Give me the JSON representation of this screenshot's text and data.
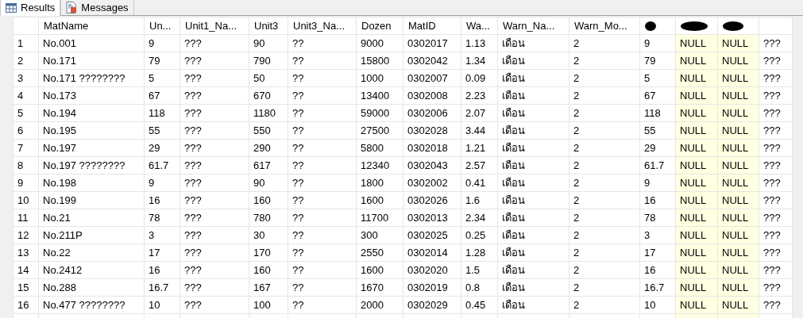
{
  "tabs": [
    {
      "label": "Results",
      "selected": true
    },
    {
      "label": "Messages",
      "selected": false
    }
  ],
  "table": {
    "columns": [
      {
        "kind": "blank"
      },
      {
        "kind": "text",
        "label": "MatName"
      },
      {
        "kind": "text",
        "label": "Un..."
      },
      {
        "kind": "text",
        "label": "Unit1_Na..."
      },
      {
        "kind": "text",
        "label": "Unit3"
      },
      {
        "kind": "text",
        "label": "Unit3_Na..."
      },
      {
        "kind": "text",
        "label": "Dozen"
      },
      {
        "kind": "text",
        "label": "MatID"
      },
      {
        "kind": "text",
        "label": "Wa..."
      },
      {
        "kind": "text",
        "label": "Warn_Na..."
      },
      {
        "kind": "text",
        "label": "Warn_Mo..."
      },
      {
        "kind": "redacted"
      },
      {
        "kind": "redacted"
      },
      {
        "kind": "redacted"
      },
      {
        "kind": "blank"
      }
    ],
    "rows": [
      [
        "1",
        "No.001",
        "9",
        "???",
        "90",
        "??",
        "9000",
        "0302017",
        "1.13",
        "เดือน",
        "2",
        "9",
        "NULL",
        "NULL",
        "???"
      ],
      [
        "2",
        "No.171",
        "79",
        "???",
        "790",
        "??",
        "15800",
        "0302042",
        "1.34",
        "เดือน",
        "2",
        "79",
        "NULL",
        "NULL",
        "???"
      ],
      [
        "3",
        "No.171 ????????",
        "5",
        "???",
        "50",
        "??",
        "1000",
        "0302007",
        "0.09",
        "เดือน",
        "2",
        "5",
        "NULL",
        "NULL",
        "???"
      ],
      [
        "4",
        "No.173",
        "67",
        "???",
        "670",
        "??",
        "13400",
        "0302008",
        "2.23",
        "เดือน",
        "2",
        "67",
        "NULL",
        "NULL",
        "???"
      ],
      [
        "5",
        "No.194",
        "118",
        "???",
        "1180",
        "??",
        "59000",
        "0302006",
        "2.07",
        "เดือน",
        "2",
        "118",
        "NULL",
        "NULL",
        "???"
      ],
      [
        "6",
        "No.195",
        "55",
        "???",
        "550",
        "??",
        "27500",
        "0302028",
        "3.44",
        "เดือน",
        "2",
        "55",
        "NULL",
        "NULL",
        "???"
      ],
      [
        "7",
        "No.197",
        "29",
        "???",
        "290",
        "??",
        "5800",
        "0302018",
        "1.21",
        "เดือน",
        "2",
        "29",
        "NULL",
        "NULL",
        "???"
      ],
      [
        "8",
        "No.197 ????????",
        "61.7",
        "???",
        "617",
        "??",
        "12340",
        "0302043",
        "2.57",
        "เดือน",
        "2",
        "61.7",
        "NULL",
        "NULL",
        "???"
      ],
      [
        "9",
        "No.198",
        "9",
        "???",
        "90",
        "??",
        "1800",
        "0302002",
        "0.41",
        "เดือน",
        "2",
        "9",
        "NULL",
        "NULL",
        "???"
      ],
      [
        "10",
        "No.199",
        "16",
        "???",
        "160",
        "??",
        "1600",
        "0302026",
        "1.6",
        "เดือน",
        "2",
        "16",
        "NULL",
        "NULL",
        "???"
      ],
      [
        "11",
        "No.21",
        "78",
        "???",
        "780",
        "??",
        "11700",
        "0302013",
        "2.34",
        "เดือน",
        "2",
        "78",
        "NULL",
        "NULL",
        "???"
      ],
      [
        "12",
        "No.211P",
        "3",
        "???",
        "30",
        "??",
        "300",
        "0302025",
        "0.25",
        "เดือน",
        "2",
        "3",
        "NULL",
        "NULL",
        "???"
      ],
      [
        "13",
        "No.22",
        "17",
        "???",
        "170",
        "??",
        "2550",
        "0302014",
        "1.28",
        "เดือน",
        "2",
        "17",
        "NULL",
        "NULL",
        "???"
      ],
      [
        "14",
        "No.2412",
        "16",
        "???",
        "160",
        "??",
        "1600",
        "0302020",
        "1.5",
        "เดือน",
        "2",
        "16",
        "NULL",
        "NULL",
        "???"
      ],
      [
        "15",
        "No.288",
        "16.7",
        "???",
        "167",
        "??",
        "1670",
        "0302019",
        "0.8",
        "เดือน",
        "2",
        "16.7",
        "NULL",
        "NULL",
        "???"
      ],
      [
        "16",
        "No.477 ????????",
        "10",
        "???",
        "100",
        "??",
        "2000",
        "0302029",
        "0.45",
        "เดือน",
        "2",
        "10",
        "NULL",
        "NULL",
        "???"
      ]
    ]
  }
}
